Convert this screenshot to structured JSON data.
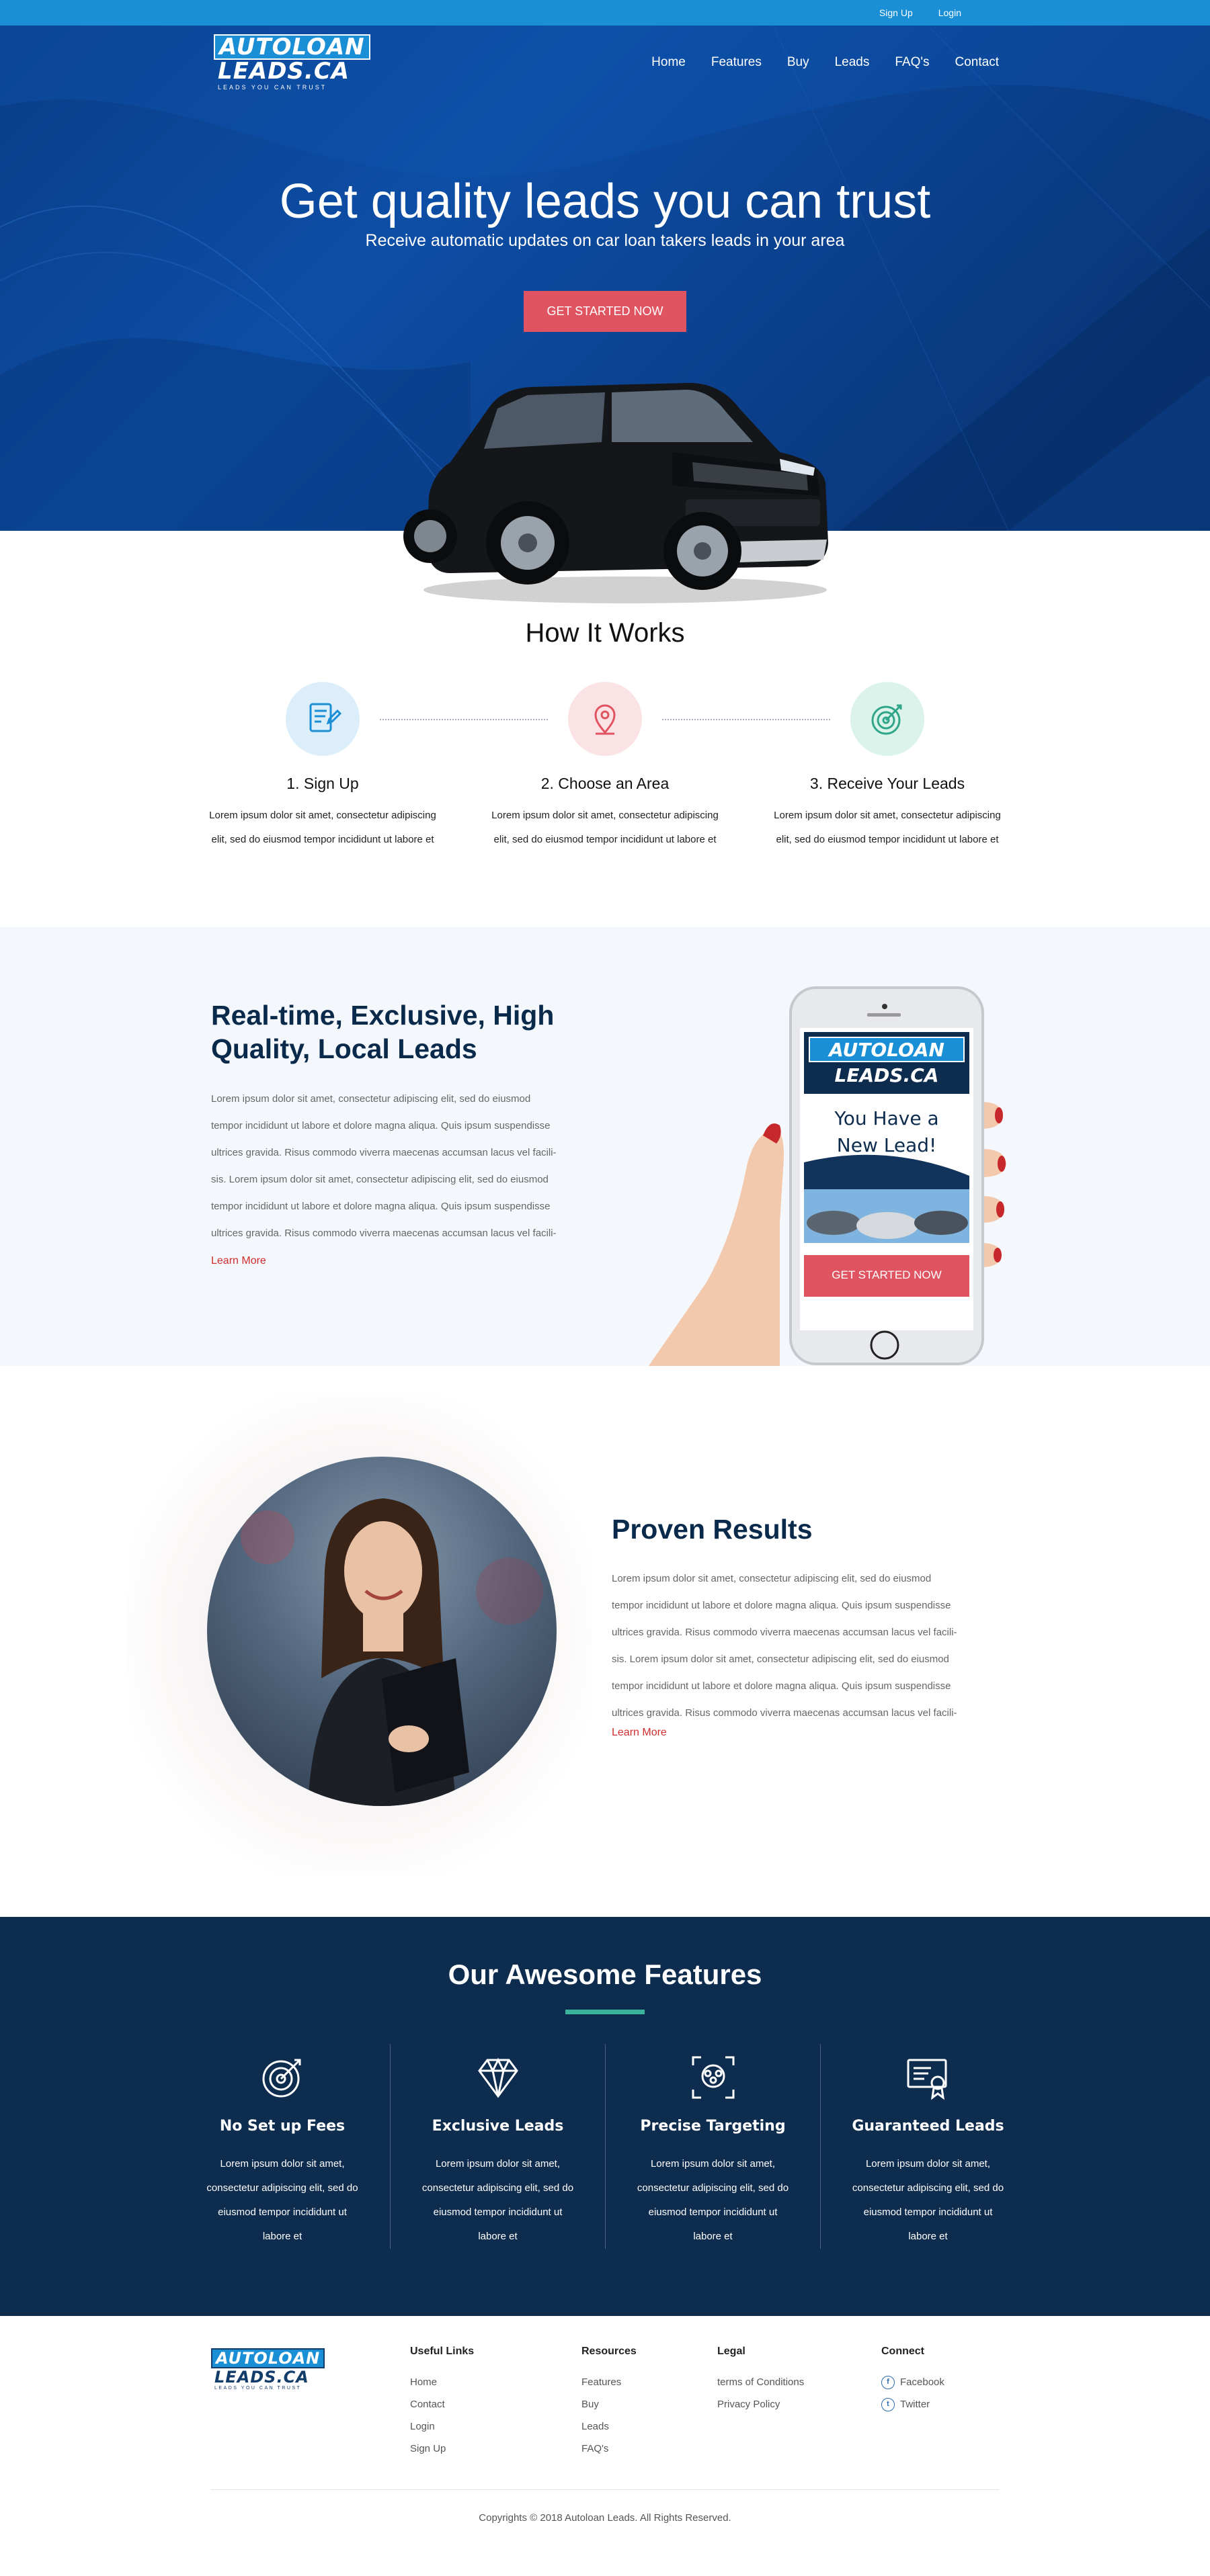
{
  "topbar": {
    "signup": "Sign Up",
    "login": "Login"
  },
  "brand": {
    "line1": "AUTOLOAN",
    "line2": "LEADS.CA",
    "tagline": "LEADS YOU CAN TRUST"
  },
  "nav": {
    "items": [
      "Home",
      "Features",
      "Buy",
      "Leads",
      "FAQ's",
      "Contact"
    ]
  },
  "hero": {
    "title": "Get quality leads you can trust",
    "subtitle": "Receive automatic updates on car loan takers leads in your area",
    "cta": "GET STARTED NOW"
  },
  "how": {
    "title": "How It Works",
    "steps": [
      {
        "title": "1. Sign Up",
        "text": "Lorem ipsum dolor sit amet, consectetur adipiscing elit, sed do eiusmod tempor incididunt ut labore et",
        "icon": "document-pen-icon",
        "color": "#1a8fd6",
        "bg": "#dceefa"
      },
      {
        "title": "2. Choose an Area",
        "text": "Lorem ipsum dolor sit amet, consectetur adipiscing elit, sed do eiusmod tempor incididunt ut labore et",
        "icon": "map-pin-icon",
        "color": "#e05361",
        "bg": "#fbe3e5"
      },
      {
        "title": "3. Receive Your Leads",
        "text": "Lorem ipsum dolor sit amet, consectetur adipiscing elit, sed do eiusmod tempor incididunt ut labore et",
        "icon": "target-icon",
        "color": "#2fa58a",
        "bg": "#dcf3ec"
      }
    ]
  },
  "realtime": {
    "title": "Real-time, Exclusive, High Quality, Local Leads",
    "lines": [
      "Lorem ipsum dolor sit amet, consectetur adipiscing elit, sed do eiusmod",
      "tempor incididunt ut labore et dolore magna aliqua. Quis ipsum suspendisse",
      "ultrices gravida. Risus commodo viverra maecenas accumsan lacus vel facili-",
      "sis. Lorem ipsum dolor sit amet, consectetur adipiscing elit, sed do eiusmod",
      "tempor incididunt ut labore et dolore magna aliqua. Quis ipsum suspendisse",
      "ultrices gravida. Risus commodo viverra maecenas accumsan lacus vel facili-"
    ],
    "link": "Learn More",
    "phone": {
      "line1": "You Have a",
      "line2": "New Lead!",
      "cta": "GET STARTED NOW"
    }
  },
  "proven": {
    "title": "Proven Results",
    "lines": [
      "Lorem ipsum dolor sit amet, consectetur adipiscing elit, sed do eiusmod",
      "tempor incididunt ut labore et dolore magna aliqua. Quis ipsum suspendisse",
      "ultrices gravida. Risus commodo viverra maecenas accumsan lacus vel facili-",
      "sis. Lorem ipsum dolor sit amet, consectetur adipiscing elit, sed do eiusmod",
      "tempor incididunt ut labore et dolore magna aliqua. Quis ipsum suspendisse",
      "ultrices gravida. Risus commodo viverra maecenas accumsan lacus vel facili-"
    ],
    "link": "Learn More"
  },
  "features": {
    "title": "Our Awesome Features",
    "accent": "#3bb39a",
    "items": [
      {
        "title": "No Set up Fees",
        "text": "Lorem ipsum dolor sit amet, consectetur adipiscing elit, sed do eiusmod tempor incididunt ut labore et",
        "icon": "target-icon"
      },
      {
        "title": "Exclusive Leads",
        "text": "Lorem ipsum dolor sit amet, consectetur adipiscing elit, sed do eiusmod tempor incididunt ut labore et",
        "icon": "diamond-icon"
      },
      {
        "title": "Precise Targeting",
        "text": "Lorem ipsum dolor sit amet, consectetur adipiscing elit, sed do eiusmod tempor incididunt ut labore et",
        "icon": "group-focus-icon"
      },
      {
        "title": "Guaranteed Leads",
        "text": "Lorem ipsum dolor sit amet, consectetur adipiscing elit, sed do eiusmod tempor incididunt ut labore et",
        "icon": "certificate-icon"
      }
    ]
  },
  "footer": {
    "useful": {
      "title": "Useful Links",
      "links": [
        "Home",
        "Contact",
        "Login",
        "Sign Up"
      ]
    },
    "resources": {
      "title": "Resources",
      "links": [
        "Features",
        "Buy",
        "Leads",
        "FAQ's"
      ]
    },
    "legal": {
      "title": "Legal",
      "links": [
        "terms of Conditions",
        "Privacy Policy"
      ]
    },
    "connect": {
      "title": "Connect",
      "links": [
        "Facebook",
        "Twitter"
      ]
    },
    "copyright": "Copyrights © 2018 Autoloan Leads. All Rights Reserved."
  },
  "colors": {
    "primary": "#1a8fd6",
    "navy": "#0e2c4e",
    "cta": "#e05361",
    "link": "#d22c2c"
  }
}
